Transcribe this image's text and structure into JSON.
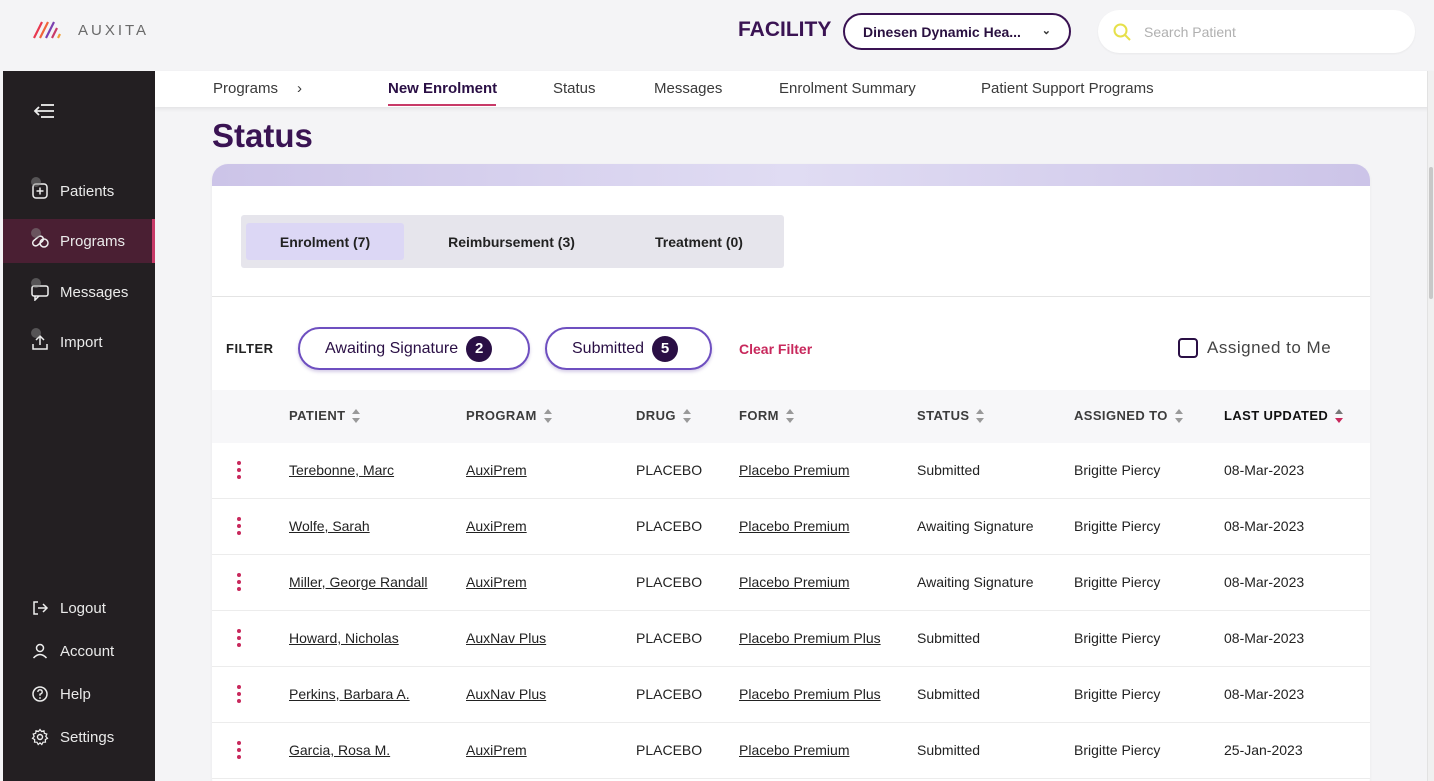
{
  "brand": {
    "name": "AUXITA"
  },
  "header": {
    "facility_label": "FACILITY",
    "facility_value": "Dinesen Dynamic Hea...",
    "search_placeholder": "Search Patient"
  },
  "sidebar": {
    "items": [
      {
        "label": "Patients",
        "icon": "patient-icon"
      },
      {
        "label": "Programs",
        "icon": "pills-icon",
        "active": true
      },
      {
        "label": "Messages",
        "icon": "message-icon"
      },
      {
        "label": "Import",
        "icon": "upload-icon"
      }
    ],
    "bottom_items": [
      {
        "label": "Logout",
        "icon": "logout-icon"
      },
      {
        "label": "Account",
        "icon": "user-icon"
      },
      {
        "label": "Help",
        "icon": "help-icon"
      },
      {
        "label": "Settings",
        "icon": "gear-icon"
      }
    ]
  },
  "subnav": {
    "items": [
      "Programs",
      "New Enrolment",
      "Status",
      "Messages",
      "Enrolment Summary",
      "Patient Support Programs"
    ],
    "active": "New Enrolment"
  },
  "page": {
    "title": "Status"
  },
  "tabs": [
    {
      "label": "Enrolment (7)",
      "active": true
    },
    {
      "label": "Reimbursement (3)"
    },
    {
      "label": "Treatment (0)"
    }
  ],
  "filter": {
    "label": "FILTER",
    "chips": [
      {
        "label": "Awaiting Signature",
        "count": "2"
      },
      {
        "label": "Submitted",
        "count": "5"
      }
    ],
    "clear_label": "Clear Filter",
    "assigned_label": "Assigned to Me"
  },
  "table": {
    "columns": [
      "PATIENT",
      "PROGRAM",
      "DRUG",
      "FORM",
      "STATUS",
      "ASSIGNED TO",
      "LAST UPDATED"
    ],
    "sorted_column": "LAST UPDATED",
    "rows": [
      [
        "Terebonne, Marc",
        "AuxiPrem",
        "PLACEBO",
        "Placebo Premium",
        "Submitted",
        "Brigitte Piercy",
        "08-Mar-2023"
      ],
      [
        "Wolfe, Sarah",
        "AuxiPrem",
        "PLACEBO",
        "Placebo Premium",
        "Awaiting Signature",
        "Brigitte Piercy",
        "08-Mar-2023"
      ],
      [
        "Miller, George Randall",
        "AuxiPrem",
        "PLACEBO",
        "Placebo Premium",
        "Awaiting Signature",
        "Brigitte Piercy",
        "08-Mar-2023"
      ],
      [
        "Howard, Nicholas",
        "AuxNav Plus",
        "PLACEBO",
        "Placebo Premium Plus",
        "Submitted",
        "Brigitte Piercy",
        "08-Mar-2023"
      ],
      [
        "Perkins, Barbara A.",
        "AuxNav Plus",
        "PLACEBO",
        "Placebo Premium Plus",
        "Submitted",
        "Brigitte Piercy",
        "08-Mar-2023"
      ],
      [
        "Garcia, Rosa M.",
        "AuxiPrem",
        "PLACEBO",
        "Placebo Premium",
        "Submitted",
        "Brigitte Piercy",
        "25-Jan-2023"
      ]
    ]
  },
  "colors": {
    "brand_purple": "#3a1353",
    "accent_pink": "#c8285c",
    "sidebar_bg": "#231f22"
  }
}
